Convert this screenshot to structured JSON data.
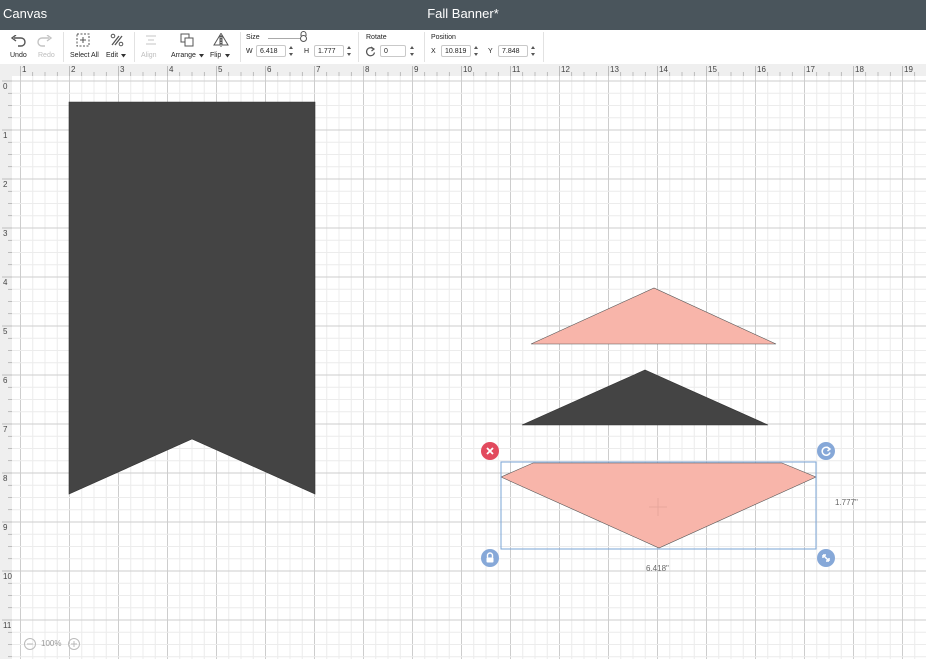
{
  "header": {
    "app": "Canvas",
    "doc": "Fall Banner*"
  },
  "toolbar": {
    "undo": "Undo",
    "redo": "Redo",
    "select_all": "Select All",
    "edit": "Edit",
    "align": "Align",
    "arrange": "Arrange",
    "flip": "Flip",
    "size_label": "Size",
    "w_label": "W",
    "w": "6.418",
    "h_label": "H",
    "h": "1.777",
    "rotate_label": "Rotate",
    "rotate": "0",
    "position_label": "Position",
    "x_label": "X",
    "x": "10.819",
    "y_label": "Y",
    "y": "7.848"
  },
  "ruler": {
    "top": [
      "1",
      "2",
      "3",
      "4",
      "5",
      "6",
      "7",
      "8",
      "9",
      "10",
      "11",
      "12",
      "13",
      "14",
      "15",
      "16",
      "17",
      "18",
      "19"
    ],
    "left": [
      "0",
      "1",
      "2",
      "3",
      "4",
      "5",
      "6",
      "7",
      "8",
      "9",
      "10",
      "11"
    ]
  },
  "selection": {
    "width": "6.418\"",
    "height": "1.777\""
  },
  "zoom": "100%",
  "colors": {
    "header": "#4a555c",
    "dark": "#444444",
    "pink": "#f8b5aa",
    "selection": "#7aa4d6",
    "delete": "#e24a5e",
    "handle": "#86a8d8"
  }
}
